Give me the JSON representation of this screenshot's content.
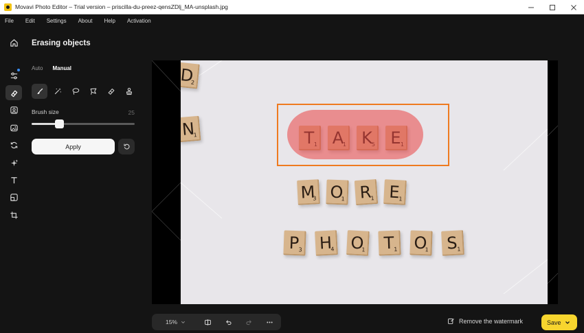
{
  "window": {
    "title": "Movavi Photo Editor – Trial version – priscilla-du-preez-qensZDlj_MA-unsplash.jpg",
    "controls": [
      "minimize-icon",
      "maximize-icon",
      "close-icon"
    ]
  },
  "menu": [
    "File",
    "Edit",
    "Settings",
    "About",
    "Help",
    "Activation"
  ],
  "rail": {
    "items": [
      {
        "icon": "home-icon"
      },
      {
        "icon": "adjust-sliders-icon",
        "badge": true
      },
      {
        "icon": "eraser-icon",
        "active": true
      },
      {
        "icon": "portrait-icon"
      },
      {
        "icon": "image-icon"
      },
      {
        "icon": "replace-icon"
      },
      {
        "icon": "sparkle-icon"
      },
      {
        "icon": "text-icon"
      },
      {
        "icon": "frame-icon"
      },
      {
        "icon": "crop-icon"
      }
    ]
  },
  "panel": {
    "title": "Erasing objects",
    "modes": [
      {
        "label": "Auto",
        "active": false
      },
      {
        "label": "Manual",
        "active": true
      }
    ],
    "tools": [
      {
        "icon": "brush-icon",
        "active": true
      },
      {
        "icon": "magic-wand-icon"
      },
      {
        "icon": "lasso-icon"
      },
      {
        "icon": "polygon-lasso-icon"
      },
      {
        "icon": "eraser-tool-icon"
      },
      {
        "icon": "clone-stamp-icon"
      }
    ],
    "brush": {
      "label": "Brush size",
      "value": "25",
      "fraction": 0.25
    },
    "apply_label": "Apply",
    "reset_icon": "reset-icon"
  },
  "photo": {
    "words": [
      {
        "letters": [
          {
            "ch": "D",
            "sc": "2"
          }
        ]
      },
      {
        "letters": [
          {
            "ch": "N",
            "sc": "1"
          }
        ]
      },
      {
        "letters": [
          {
            "ch": "T",
            "sc": "1"
          },
          {
            "ch": "A",
            "sc": "1"
          },
          {
            "ch": "K",
            "sc": "5"
          },
          {
            "ch": "E",
            "sc": "1"
          }
        ]
      },
      {
        "letters": [
          {
            "ch": "M",
            "sc": "3"
          },
          {
            "ch": "O",
            "sc": "1"
          },
          {
            "ch": "R",
            "sc": "1"
          },
          {
            "ch": "E",
            "sc": "1"
          }
        ]
      },
      {
        "letters": [
          {
            "ch": "P",
            "sc": "3"
          },
          {
            "ch": "H",
            "sc": "4"
          },
          {
            "ch": "O",
            "sc": "1"
          },
          {
            "ch": "T",
            "sc": "1"
          },
          {
            "ch": "O",
            "sc": "1"
          },
          {
            "ch": "S",
            "sc": "1"
          }
        ]
      }
    ]
  },
  "bottom": {
    "zoom": "15%",
    "tools": [
      "compare-icon",
      "undo-icon",
      "redo-icon",
      "more-icon"
    ],
    "watermark_label": "Remove the watermark",
    "save_label": "Save"
  },
  "colors": {
    "accent_yellow": "#f7d52e",
    "selection_orange": "#ef7a1f",
    "erase_mask": "#ea4747"
  }
}
